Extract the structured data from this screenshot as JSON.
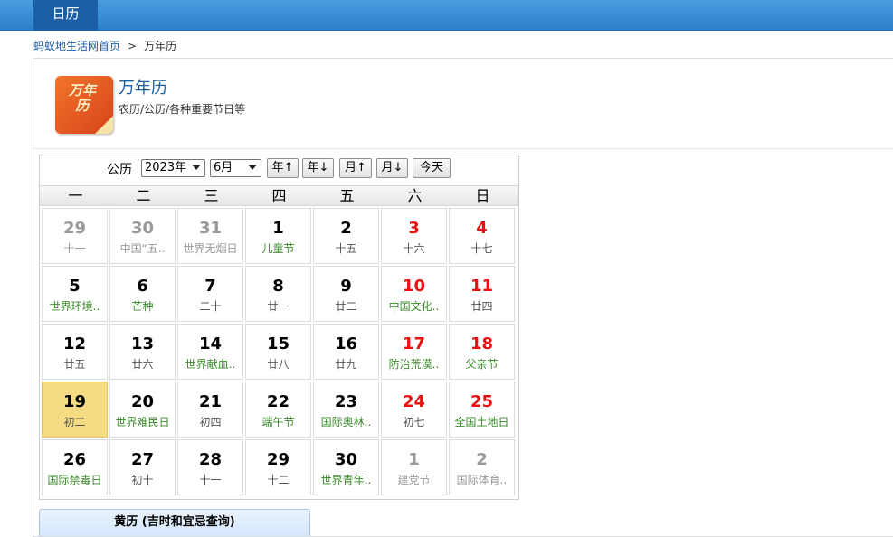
{
  "topbar": {
    "tab_label": "日历"
  },
  "breadcrumb": {
    "home": "蚂蚁地生活网首页",
    "sep": ">",
    "current": "万年历"
  },
  "app": {
    "icon_text": "万年历",
    "title": "万年历",
    "desc": "农历/公历/各种重要节日等"
  },
  "calendar": {
    "mode_label": "公历",
    "year_value": "2023年",
    "month_value": "6月",
    "buttons": {
      "year_up": "年↑",
      "year_down": "年↓",
      "month_up": "月↑",
      "month_down": "月↓",
      "today": "今天"
    },
    "weekdays": [
      "一",
      "二",
      "三",
      "四",
      "五",
      "六",
      "日"
    ],
    "weeks": [
      [
        {
          "d": "29",
          "s": "十一",
          "k": "other"
        },
        {
          "d": "30",
          "s": "中国“五..",
          "k": "other"
        },
        {
          "d": "31",
          "s": "世界无烟日",
          "k": "other"
        },
        {
          "d": "1",
          "s": "儿童节",
          "k": "fest"
        },
        {
          "d": "2",
          "s": "十五",
          "k": ""
        },
        {
          "d": "3",
          "s": "十六",
          "k": "weekend"
        },
        {
          "d": "4",
          "s": "十七",
          "k": "weekend"
        }
      ],
      [
        {
          "d": "5",
          "s": "世界环境..",
          "k": "fest"
        },
        {
          "d": "6",
          "s": "芒种",
          "k": "fest"
        },
        {
          "d": "7",
          "s": "二十",
          "k": ""
        },
        {
          "d": "8",
          "s": "廿一",
          "k": ""
        },
        {
          "d": "9",
          "s": "廿二",
          "k": ""
        },
        {
          "d": "10",
          "s": "中国文化..",
          "k": "weekend fest"
        },
        {
          "d": "11",
          "s": "廿四",
          "k": "weekend"
        }
      ],
      [
        {
          "d": "12",
          "s": "廿五",
          "k": ""
        },
        {
          "d": "13",
          "s": "廿六",
          "k": ""
        },
        {
          "d": "14",
          "s": "世界献血..",
          "k": "fest"
        },
        {
          "d": "15",
          "s": "廿八",
          "k": ""
        },
        {
          "d": "16",
          "s": "廿九",
          "k": ""
        },
        {
          "d": "17",
          "s": "防治荒漠..",
          "k": "weekend fest"
        },
        {
          "d": "18",
          "s": "父亲节",
          "k": "weekend fest"
        }
      ],
      [
        {
          "d": "19",
          "s": "初二",
          "k": "today"
        },
        {
          "d": "20",
          "s": "世界难民日",
          "k": "fest"
        },
        {
          "d": "21",
          "s": "初四",
          "k": ""
        },
        {
          "d": "22",
          "s": "端午节",
          "k": "fest"
        },
        {
          "d": "23",
          "s": "国际奥林..",
          "k": "fest"
        },
        {
          "d": "24",
          "s": "初七",
          "k": "weekend"
        },
        {
          "d": "25",
          "s": "全国土地日",
          "k": "weekend fest"
        }
      ],
      [
        {
          "d": "26",
          "s": "国际禁毒日",
          "k": "fest"
        },
        {
          "d": "27",
          "s": "初十",
          "k": ""
        },
        {
          "d": "28",
          "s": "十一",
          "k": ""
        },
        {
          "d": "29",
          "s": "十二",
          "k": ""
        },
        {
          "d": "30",
          "s": "世界青年..",
          "k": "fest"
        },
        {
          "d": "1",
          "s": "建党节",
          "k": "other fest"
        },
        {
          "d": "2",
          "s": "国际体育..",
          "k": "other fest"
        }
      ]
    ]
  },
  "huangli": {
    "label": "黄历 (吉时和宜忌查询)"
  }
}
